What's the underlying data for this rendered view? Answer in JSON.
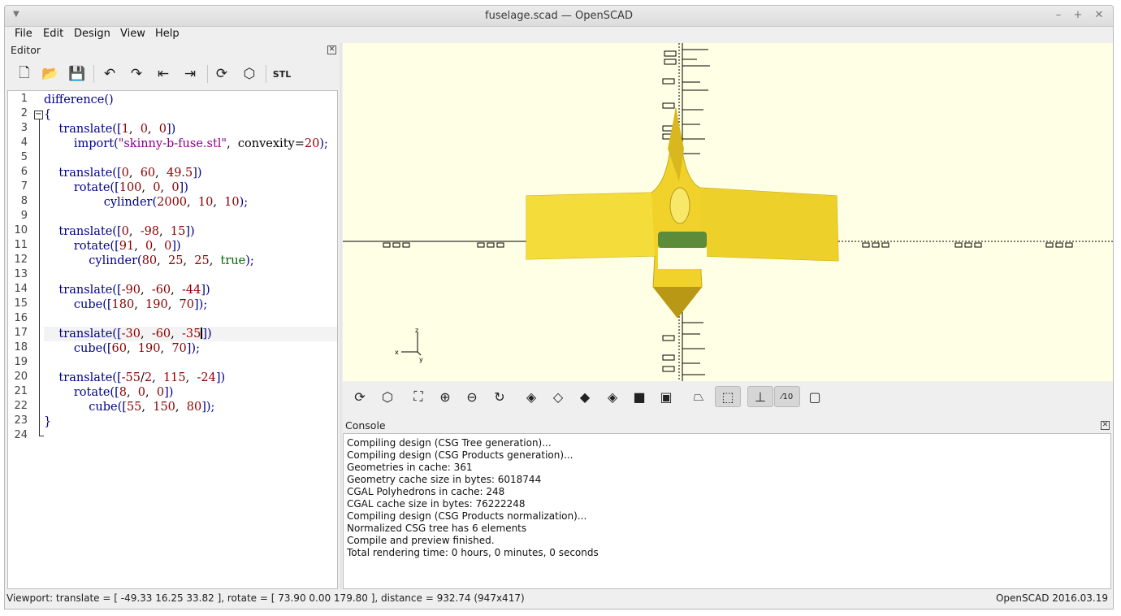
{
  "window": {
    "title": "fuselage.scad — OpenSCAD",
    "menu_arrow": "▼",
    "minimize": "–",
    "maximize": "+",
    "close": "✕"
  },
  "menubar": {
    "items": [
      "File",
      "Edit",
      "Design",
      "View",
      "Help"
    ]
  },
  "editor": {
    "title": "Editor",
    "close": "✕",
    "toolbar": [
      {
        "icon": "new-file-icon",
        "glyph": "🗋"
      },
      {
        "icon": "open-folder-icon",
        "glyph": "📂"
      },
      {
        "icon": "save-icon",
        "glyph": "💾"
      },
      {
        "icon": "undo-icon",
        "glyph": "↶"
      },
      {
        "icon": "redo-icon",
        "glyph": "↷"
      },
      {
        "icon": "unindent-icon",
        "glyph": "⇤"
      },
      {
        "icon": "indent-icon",
        "glyph": "⇥"
      },
      {
        "icon": "preview-icon",
        "glyph": "⟳"
      },
      {
        "icon": "render-icon",
        "glyph": "⬡"
      },
      {
        "icon": "export-stl-icon",
        "glyph": "STL"
      }
    ],
    "line_numbers": [
      "1",
      "2",
      "3",
      "4",
      "5",
      "6",
      "7",
      "8",
      "9",
      "10",
      "11",
      "12",
      "13",
      "14",
      "15",
      "16",
      "17",
      "18",
      "19",
      "20",
      "21",
      "22",
      "23",
      "24"
    ],
    "fold_marker": "−",
    "current_line": 17
  },
  "viewport": {
    "axis_z_label": "z",
    "axis_x_label": "x",
    "axis_y_label": "y",
    "model_color": "#f0d22a",
    "background": "#ffffe5",
    "tick_label": "□□□□"
  },
  "viewtools": [
    {
      "icon": "preview-icon",
      "glyph": "⟳"
    },
    {
      "icon": "render-icon",
      "glyph": "⬡"
    },
    {
      "icon": "view-all-icon",
      "glyph": "⛶"
    },
    {
      "icon": "zoom-in-icon",
      "glyph": "⊕"
    },
    {
      "icon": "zoom-out-icon",
      "glyph": "⊖"
    },
    {
      "icon": "reset-view-icon",
      "glyph": "↻"
    },
    {
      "icon": "view-right-icon",
      "glyph": "◈"
    },
    {
      "icon": "view-top-icon",
      "glyph": "◇"
    },
    {
      "icon": "view-bottom-icon",
      "glyph": "◆"
    },
    {
      "icon": "view-left-icon",
      "glyph": "◈"
    },
    {
      "icon": "view-front-icon",
      "glyph": "■"
    },
    {
      "icon": "view-back-icon",
      "glyph": "▣"
    },
    {
      "icon": "perspective-icon",
      "glyph": "⏢"
    },
    {
      "icon": "orthogonal-icon",
      "glyph": "⬚"
    },
    {
      "icon": "show-axes-icon",
      "glyph": "⊥"
    },
    {
      "icon": "show-scale-icon",
      "glyph": "⁄10"
    },
    {
      "icon": "show-edges-icon",
      "glyph": "▢"
    }
  ],
  "console": {
    "title": "Console",
    "close": "✕",
    "lines": [
      "Compiling design (CSG Tree generation)...",
      "Compiling design (CSG Products generation)...",
      "Geometries in cache: 361",
      "Geometry cache size in bytes: 6018744",
      "CGAL Polyhedrons in cache: 248",
      "CGAL cache size in bytes: 76222248",
      "Compiling design (CSG Products normalization)...",
      "Normalized CSG tree has 6 elements",
      "Compile and preview finished.",
      "Total rendering time: 0 hours, 0 minutes, 0 seconds"
    ]
  },
  "status": {
    "viewport": "Viewport: translate = [ -49.33 16.25 33.82 ], rotate = [ 73.90 0.00 179.80 ], distance = 932.74 (947x417)",
    "version": "OpenSCAD 2016.03.19"
  },
  "code": {
    "l1": {
      "a": "difference()"
    },
    "l2": {
      "a": "{"
    },
    "l3": {
      "a": "    translate([",
      "n1": "1",
      "s1": ",  ",
      "n2": "0",
      "s2": ",  ",
      "n3": "0",
      "b": "])"
    },
    "l4": {
      "a": "        import(",
      "str": "\"skinny-b-fuse.stl\"",
      "b": ",  convexity=",
      "n1": "20",
      "c": ");"
    },
    "l6": {
      "a": "    translate([",
      "n1": "0",
      "s1": ",  ",
      "n2": "60",
      "s2": ",  ",
      "n3": "49.5",
      "b": "])"
    },
    "l7": {
      "a": "        rotate([",
      "n1": "100",
      "s1": ",  ",
      "n2": "0",
      "s2": ",  ",
      "n3": "0",
      "b": "])"
    },
    "l8": {
      "a": "                cylinder(",
      "n1": "2000",
      "s1": ",  ",
      "n2": "10",
      "s2": ",  ",
      "n3": "10",
      "b": ");"
    },
    "l10": {
      "a": "    translate([",
      "n1": "0",
      "s1": ",  ",
      "n2": "-98",
      "s2": ",  ",
      "n3": "15",
      "b": "])"
    },
    "l11": {
      "a": "        rotate([",
      "n1": "91",
      "s1": ",  ",
      "n2": "0",
      "s2": ",  ",
      "n3": "0",
      "b": "])"
    },
    "l12": {
      "a": "            cylinder(",
      "n1": "80",
      "s1": ",  ",
      "n2": "25",
      "s2": ",  ",
      "n3": "25",
      "s3": ",  ",
      "bool": "true",
      "b": ");"
    },
    "l14": {
      "a": "    translate([",
      "n1": "-90",
      "s1": ",  ",
      "n2": "-60",
      "s2": ",  ",
      "n3": "-44",
      "b": "])"
    },
    "l15": {
      "a": "        cube([",
      "n1": "180",
      "s1": ",  ",
      "n2": "190",
      "s2": ",  ",
      "n3": "70",
      "b": "]);"
    },
    "l17": {
      "a": "    translate([",
      "n1": "-30",
      "s1": ",  ",
      "n2": "-60",
      "s2": ",  ",
      "n3": "-35",
      "b": "])"
    },
    "l18": {
      "a": "        cube([",
      "n1": "60",
      "s1": ",  ",
      "n2": "190",
      "s2": ",  ",
      "n3": "70",
      "b": "]);"
    },
    "l20": {
      "a": "    translate([",
      "n1": "-55",
      "s0": "/",
      "n1b": "2",
      "s1": ",  ",
      "n2": "115",
      "s2": ",  ",
      "n3": "-24",
      "b": "])"
    },
    "l21": {
      "a": "        rotate([",
      "n1": "8",
      "s1": ",  ",
      "n2": "0",
      "s2": ",  ",
      "n3": "0",
      "b": "])"
    },
    "l22": {
      "a": "            cube([",
      "n1": "55",
      "s1": ",  ",
      "n2": "150",
      "s2": ",  ",
      "n3": "80",
      "b": "]);"
    },
    "l23": {
      "a": "}"
    }
  }
}
